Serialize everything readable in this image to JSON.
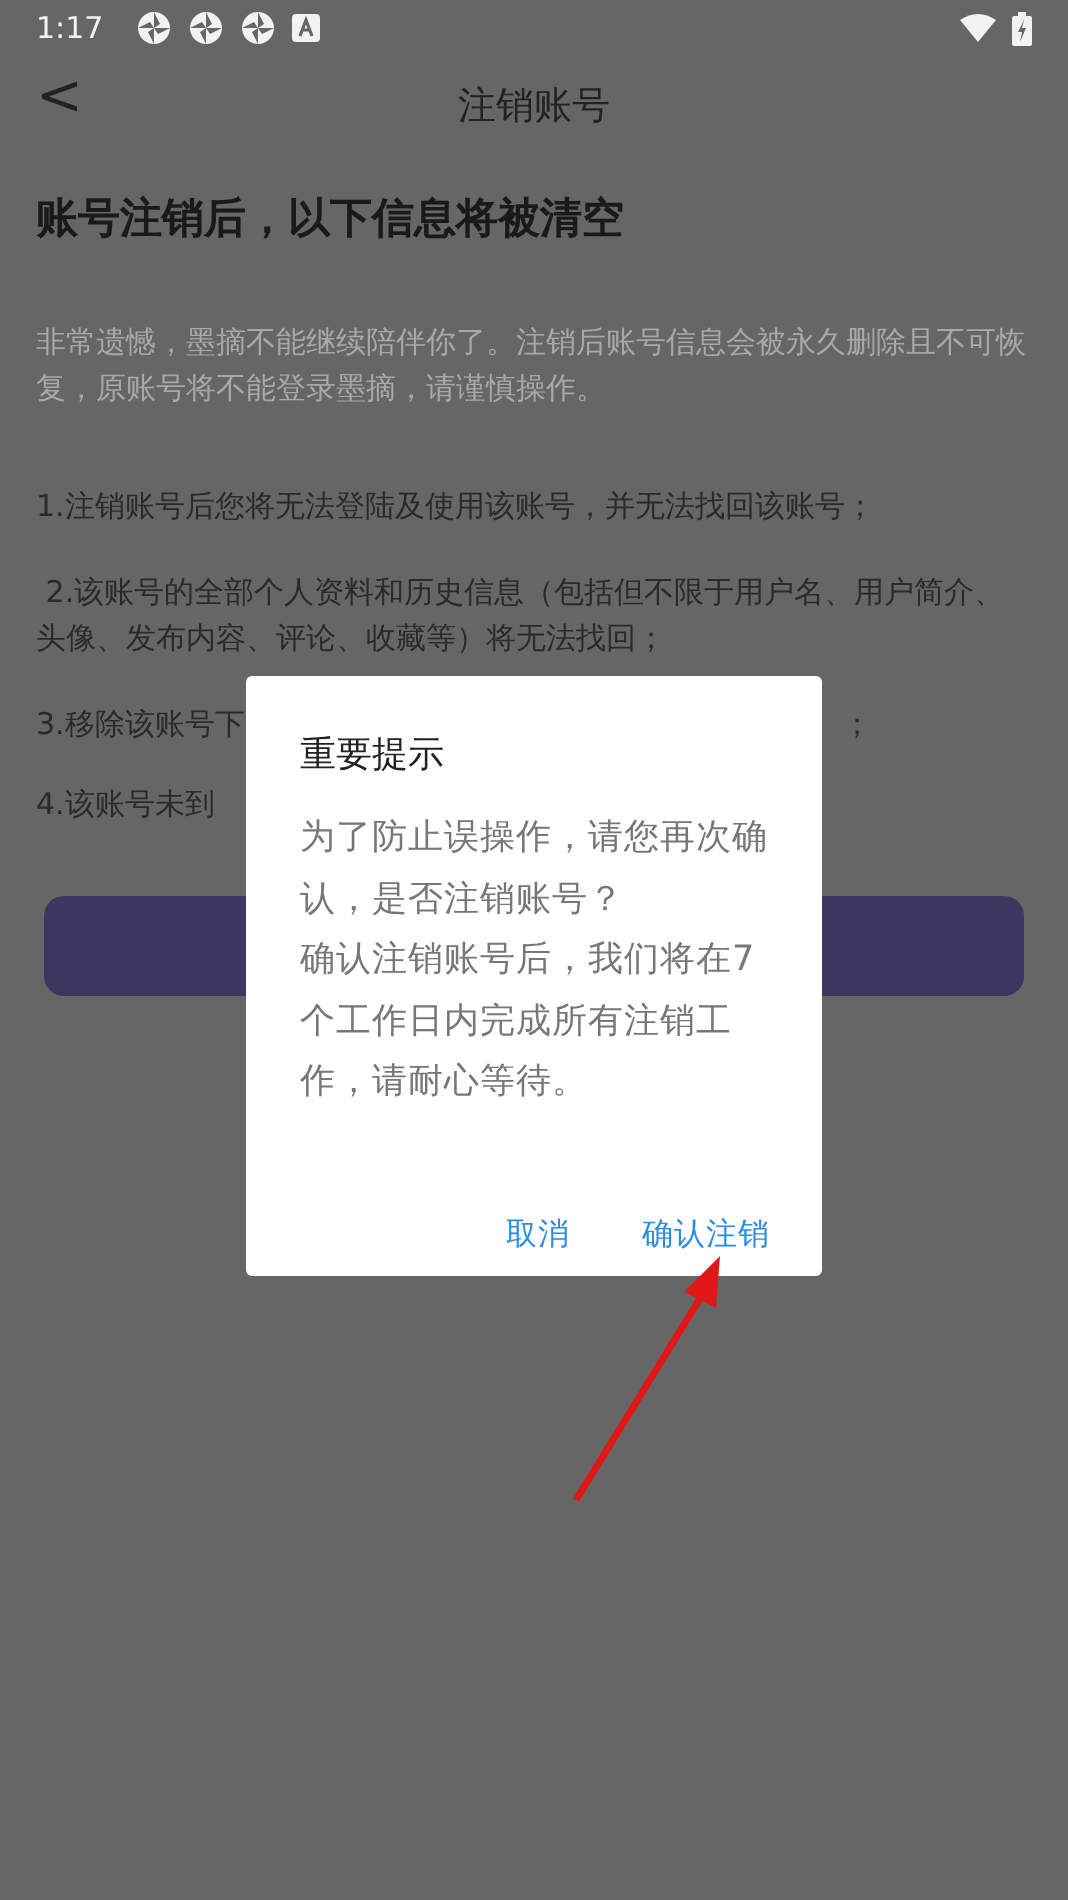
{
  "status_bar": {
    "time": "1:17"
  },
  "header": {
    "back": "<",
    "title": "注销账号"
  },
  "heading": "账号注销后，以下信息将被清空",
  "intro": "非常遗憾，墨摘不能继续陪伴你了。注销后账号信息会被永久删除且不可恢复，原账号将不能登录墨摘，请谨慎操作。",
  "items": [
    {
      "text": "1.注销账号后您将无法登陆及使用该账号，并无法找回该账号；"
    },
    {
      "text": " 2.该账号的全部个人资料和历史信息（包括但不限于用户名、用户简介、头像、发布内容、评论、收藏等）将无法找回；"
    },
    {
      "text": "3.移除该账号下",
      "tail": "；"
    },
    {
      "text": "4.该账号未到"
    }
  ],
  "dialog": {
    "title": "重要提示",
    "paragraphs": [
      "为了防止误操作，请您再次确认，是否注销账号？",
      "确认注销账号后，我们将在7个工作日内完成所有注销工作，请耐心等待。"
    ],
    "buttons": [
      {
        "label": "取消"
      },
      {
        "label": "确认注销"
      }
    ]
  }
}
